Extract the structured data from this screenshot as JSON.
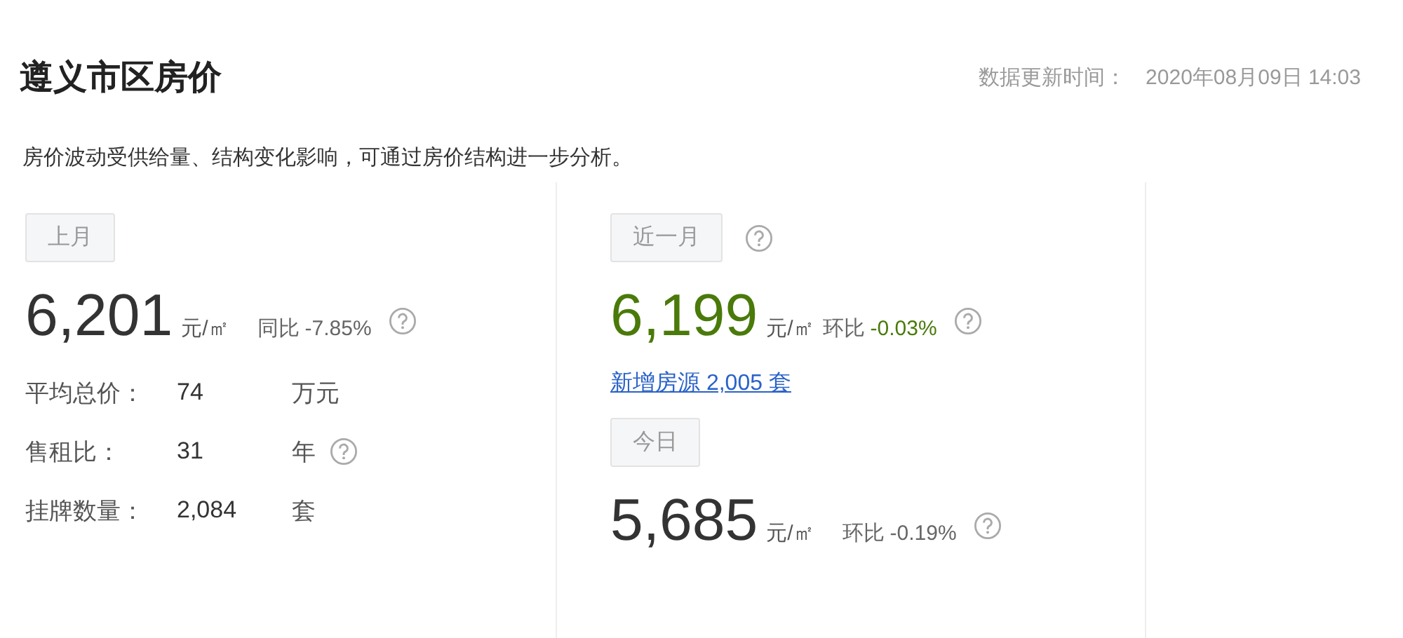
{
  "header": {
    "title": "遵义市区房价",
    "update_label": "数据更新时间：",
    "update_time": "2020年08月09日 14:03"
  },
  "note": "房价波动受供给量、结构变化影响，可通过房价结构进一步分析。",
  "panels": [
    {
      "blocks": [
        {
          "kind": "tag",
          "label": "上月",
          "help": false
        },
        {
          "kind": "price",
          "value": "6,201",
          "unit": "元/㎡",
          "change_label": "同比",
          "change": "-7.85%",
          "highlight": false,
          "help": true
        },
        {
          "kind": "stats",
          "rows": [
            {
              "label": "平均总价：",
              "value": "74",
              "unit": "万元",
              "help": false
            },
            {
              "label": "售租比：",
              "value": "31",
              "unit": "年",
              "help": true
            },
            {
              "label": "挂牌数量：",
              "value": "2,084",
              "unit": "套",
              "help": false
            }
          ]
        }
      ]
    },
    {
      "blocks": [
        {
          "kind": "tag",
          "label": "近一月",
          "help": true
        },
        {
          "kind": "price",
          "value": "6,199",
          "unit": "元/㎡",
          "change_label": "环比",
          "change": "-0.03%",
          "highlight": true,
          "help": true
        },
        {
          "kind": "link",
          "text": "新增房源 2,005 套"
        },
        {
          "kind": "tag",
          "label": "今日",
          "help": false
        },
        {
          "kind": "price",
          "value": "5,685",
          "unit": "元/㎡",
          "change_label": "环比",
          "change": "-0.19%",
          "highlight": false,
          "help": true
        }
      ]
    }
  ]
}
